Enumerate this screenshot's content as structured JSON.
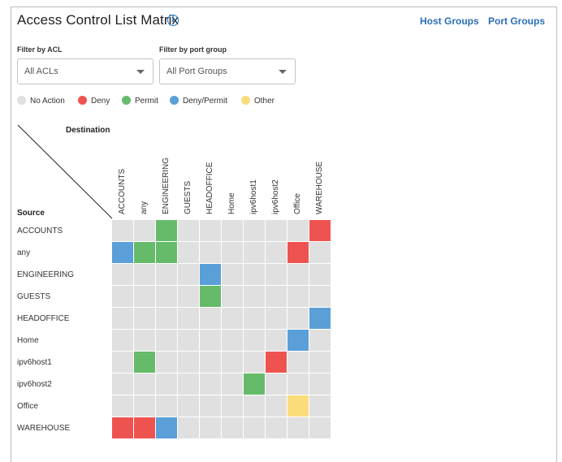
{
  "title": "Access Control List Matrix",
  "links": {
    "host_groups": "Host Groups",
    "port_groups": "Port Groups"
  },
  "filters": {
    "acl_label": "Filter by ACL",
    "acl_value": "All ACLs",
    "port_group_label": "Filter by port group",
    "port_group_value": "All Port Groups"
  },
  "legend": [
    {
      "label": "No Action",
      "color": "#e0e0e0"
    },
    {
      "label": "Deny",
      "color": "#ef5350"
    },
    {
      "label": "Permit",
      "color": "#66bb6a"
    },
    {
      "label": "Deny/Permit",
      "color": "#5a9fd8"
    },
    {
      "label": "Other",
      "color": "#fbdc7a"
    }
  ],
  "matrix": {
    "destination_label": "Destination",
    "source_label": "Source",
    "columns": [
      "ACCOUNTS",
      "any",
      "ENGINEERING",
      "GUESTS",
      "HEADOFFICE",
      "Home",
      "ipv6host1",
      "ipv6host2",
      "Office",
      "WAREHOUSE"
    ],
    "rows": [
      "ACCOUNTS",
      "any",
      "ENGINEERING",
      "GUESTS",
      "HEADOFFICE",
      "Home",
      "ipv6host1",
      "ipv6host2",
      "Office",
      "WAREHOUSE"
    ],
    "states": [
      [
        0,
        0,
        2,
        0,
        0,
        0,
        0,
        0,
        0,
        1
      ],
      [
        3,
        2,
        2,
        0,
        0,
        0,
        0,
        0,
        1,
        0
      ],
      [
        0,
        0,
        0,
        0,
        3,
        0,
        0,
        0,
        0,
        0
      ],
      [
        0,
        0,
        0,
        0,
        2,
        0,
        0,
        0,
        0,
        0
      ],
      [
        0,
        0,
        0,
        0,
        0,
        0,
        0,
        0,
        0,
        3
      ],
      [
        0,
        0,
        0,
        0,
        0,
        0,
        0,
        0,
        3,
        0
      ],
      [
        0,
        2,
        0,
        0,
        0,
        0,
        0,
        1,
        0,
        0
      ],
      [
        0,
        0,
        0,
        0,
        0,
        0,
        2,
        0,
        0,
        0
      ],
      [
        0,
        0,
        0,
        0,
        0,
        0,
        0,
        0,
        4,
        0
      ],
      [
        1,
        1,
        3,
        0,
        0,
        0,
        0,
        0,
        0,
        0
      ]
    ]
  }
}
